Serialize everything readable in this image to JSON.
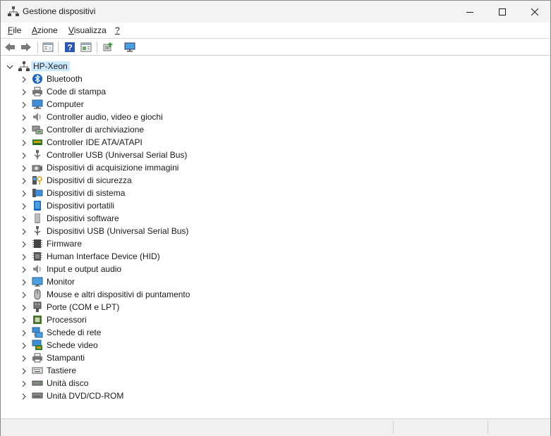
{
  "window": {
    "title": "Gestione dispositivi"
  },
  "menu": [
    {
      "key": "file",
      "underline": "F",
      "rest": "ile"
    },
    {
      "key": "azione",
      "underline": "A",
      "rest": "zione"
    },
    {
      "key": "visualizza",
      "underline": "V",
      "rest": "isualizza"
    },
    {
      "key": "help",
      "underline": "?",
      "rest": ""
    }
  ],
  "toolbar": [
    "back-icon",
    "forward-icon",
    "properties-view-icon",
    "help-icon",
    "details-view-icon",
    "scan-hardware-icon",
    "monitor-icon"
  ],
  "tree": {
    "root": "HP-Xeon",
    "categories": [
      {
        "label": "Bluetooth",
        "icon": "bluetooth-icon"
      },
      {
        "label": "Code di stampa",
        "icon": "printer-icon"
      },
      {
        "label": "Computer",
        "icon": "computer-icon"
      },
      {
        "label": "Controller audio, video e giochi",
        "icon": "speaker-icon"
      },
      {
        "label": "Controller di archiviazione",
        "icon": "storage-controller-icon"
      },
      {
        "label": "Controller IDE ATA/ATAPI",
        "icon": "ide-controller-icon"
      },
      {
        "label": "Controller USB (Universal Serial Bus)",
        "icon": "usb-icon"
      },
      {
        "label": "Dispositivi di acquisizione immagini",
        "icon": "camera-icon"
      },
      {
        "label": "Dispositivi di sicurezza",
        "icon": "security-key-icon"
      },
      {
        "label": "Dispositivi di sistema",
        "icon": "system-device-icon"
      },
      {
        "label": "Dispositivi portatili",
        "icon": "portable-device-icon"
      },
      {
        "label": "Dispositivi software",
        "icon": "software-device-icon"
      },
      {
        "label": "Dispositivi USB (Universal Serial Bus)",
        "icon": "usb-icon"
      },
      {
        "label": "Firmware",
        "icon": "chip-icon"
      },
      {
        "label": "Human Interface Device (HID)",
        "icon": "hid-icon"
      },
      {
        "label": "Input e output audio",
        "icon": "speaker-icon"
      },
      {
        "label": "Monitor",
        "icon": "monitor-icon"
      },
      {
        "label": "Mouse e altri dispositivi di puntamento",
        "icon": "mouse-icon"
      },
      {
        "label": "Porte (COM e LPT)",
        "icon": "port-icon"
      },
      {
        "label": "Processori",
        "icon": "processor-icon"
      },
      {
        "label": "Schede di rete",
        "icon": "network-adapter-icon"
      },
      {
        "label": "Schede video",
        "icon": "display-adapter-icon"
      },
      {
        "label": "Stampanti",
        "icon": "printer-icon"
      },
      {
        "label": "Tastiere",
        "icon": "keyboard-icon"
      },
      {
        "label": "Unità disco",
        "icon": "disk-drive-icon"
      },
      {
        "label": "Unità DVD/CD-ROM",
        "icon": "dvd-drive-icon"
      }
    ]
  }
}
